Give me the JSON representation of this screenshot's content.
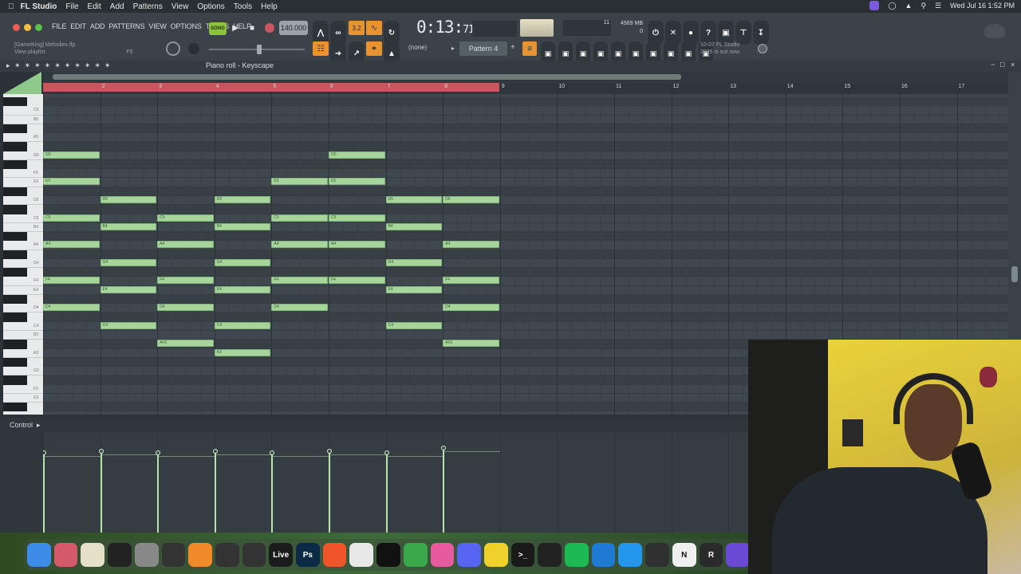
{
  "mac_menu": {
    "app_name": "FL Studio",
    "items": [
      "File",
      "Edit",
      "Add",
      "Patterns",
      "View",
      "Options",
      "Tools",
      "Help"
    ],
    "datetime": "Wed Jul 16  1:52 PM"
  },
  "toolbar": {
    "menu_items": [
      "FILE",
      "EDIT",
      "ADD",
      "PATTERNS",
      "VIEW",
      "OPTIONS",
      "TOOLS",
      "HELP"
    ],
    "project_file": "[GameKing] Melodies.flp",
    "hint_text": "View playlist",
    "hint_key": "F5",
    "song_label": "SONG",
    "tempo": "140.000",
    "time_main": "0:13:",
    "time_sub": "71",
    "pattern_name": "Pattern 4",
    "channel_none": "(none)",
    "cpu_value": "11",
    "memory": "4569 MB",
    "polyphony": "0",
    "news_date": "10-07",
    "news_title": "FL Studio",
    "news_text": "2025 is out now"
  },
  "piano_roll": {
    "title": "Piano roll - Keyscape",
    "bar_numbers": [
      "2",
      "3",
      "4",
      "5",
      "6",
      "7",
      "8",
      "9",
      "10",
      "11",
      "12",
      "13",
      "14",
      "15",
      "16",
      "17"
    ],
    "key_labels": [
      "C6",
      "B5",
      "A5",
      "G5",
      "F5",
      "E5",
      "D5",
      "C5",
      "B4",
      "A4",
      "G4",
      "F4",
      "E4",
      "D4",
      "C4",
      "B3",
      "A3",
      "G3",
      "F3",
      "E3"
    ],
    "notes": [
      {
        "label": "G5",
        "bar": 1,
        "len": 1,
        "row": "G5"
      },
      {
        "label": "G5",
        "bar": 6,
        "len": 1,
        "row": "G5"
      },
      {
        "label": "E5",
        "bar": 1,
        "len": 1,
        "row": "E5"
      },
      {
        "label": "E5",
        "bar": 5,
        "len": 1,
        "row": "E5"
      },
      {
        "label": "E5",
        "bar": 6,
        "len": 1,
        "row": "E5"
      },
      {
        "label": "D5",
        "bar": 2,
        "len": 1,
        "row": "D5"
      },
      {
        "label": "D5",
        "bar": 4,
        "len": 1,
        "row": "D5"
      },
      {
        "label": "D5",
        "bar": 7,
        "len": 1,
        "row": "D5"
      },
      {
        "label": "D5",
        "bar": 8,
        "len": 1,
        "row": "D5"
      },
      {
        "label": "C5",
        "bar": 1,
        "len": 1,
        "row": "C5"
      },
      {
        "label": "C5",
        "bar": 3,
        "len": 1,
        "row": "C5"
      },
      {
        "label": "C5",
        "bar": 5,
        "len": 1,
        "row": "C5"
      },
      {
        "label": "C5",
        "bar": 6,
        "len": 1,
        "row": "C5"
      },
      {
        "label": "B4",
        "bar": 2,
        "len": 1,
        "row": "B4"
      },
      {
        "label": "B4",
        "bar": 4,
        "len": 1,
        "row": "B4"
      },
      {
        "label": "B4",
        "bar": 7,
        "len": 1,
        "row": "B4"
      },
      {
        "label": "A4",
        "bar": 1,
        "len": 1,
        "row": "A4"
      },
      {
        "label": "A4",
        "bar": 3,
        "len": 1,
        "row": "A4"
      },
      {
        "label": "A4",
        "bar": 5,
        "len": 1,
        "row": "A4"
      },
      {
        "label": "A4",
        "bar": 6,
        "len": 1,
        "row": "A4"
      },
      {
        "label": "A4",
        "bar": 8,
        "len": 1,
        "row": "A4"
      },
      {
        "label": "G4",
        "bar": 2,
        "len": 1,
        "row": "G4"
      },
      {
        "label": "G4",
        "bar": 4,
        "len": 1,
        "row": "G4"
      },
      {
        "label": "G4",
        "bar": 7,
        "len": 1,
        "row": "G4"
      },
      {
        "label": "F4",
        "bar": 1,
        "len": 1,
        "row": "F4"
      },
      {
        "label": "F4",
        "bar": 3,
        "len": 1,
        "row": "F4"
      },
      {
        "label": "F4",
        "bar": 5,
        "len": 1,
        "row": "F4"
      },
      {
        "label": "F4",
        "bar": 6,
        "len": 1,
        "row": "F4"
      },
      {
        "label": "F4",
        "bar": 8,
        "len": 1,
        "row": "F4"
      },
      {
        "label": "E4",
        "bar": 2,
        "len": 1,
        "row": "E4"
      },
      {
        "label": "E4",
        "bar": 4,
        "len": 1,
        "row": "E4"
      },
      {
        "label": "E4",
        "bar": 7,
        "len": 1,
        "row": "E4"
      },
      {
        "label": "D4",
        "bar": 1,
        "len": 1,
        "row": "D4"
      },
      {
        "label": "D4",
        "bar": 3,
        "len": 1,
        "row": "D4"
      },
      {
        "label": "D4",
        "bar": 5,
        "len": 1,
        "row": "D4"
      },
      {
        "label": "D4",
        "bar": 8,
        "len": 1,
        "row": "D4"
      },
      {
        "label": "C4",
        "bar": 2,
        "len": 1,
        "row": "C4"
      },
      {
        "label": "C4",
        "bar": 4,
        "len": 1,
        "row": "C4"
      },
      {
        "label": "C4",
        "bar": 7,
        "len": 1,
        "row": "C4"
      },
      {
        "label": "A#3",
        "bar": 3,
        "len": 1,
        "row": "A#3"
      },
      {
        "label": "A#3",
        "bar": 8,
        "len": 1,
        "row": "A#3"
      },
      {
        "label": "A3",
        "bar": 4,
        "len": 1,
        "row": "A3"
      }
    ]
  },
  "control": {
    "label": "Control",
    "velocity_bars": [
      1,
      2,
      3,
      4,
      5,
      6,
      7,
      8
    ]
  },
  "dock": {
    "apps": [
      {
        "name": "finder-icon",
        "text": "",
        "color": "#3d8de8"
      },
      {
        "name": "launchpad-icon",
        "text": "",
        "color": "#d45a6a"
      },
      {
        "name": "notes-icon",
        "text": "",
        "color": "#e6e0c8"
      },
      {
        "name": "activity-icon",
        "text": "",
        "color": "#222"
      },
      {
        "name": "settings-icon",
        "text": "",
        "color": "#888"
      },
      {
        "name": "camera-icon",
        "text": "",
        "color": "#333"
      },
      {
        "name": "fl-studio-icon",
        "text": "",
        "color": "#f08a2a"
      },
      {
        "name": "audio-icon",
        "text": "",
        "color": "#333"
      },
      {
        "name": "gauge-icon",
        "text": "",
        "color": "#333"
      },
      {
        "name": "ableton-icon",
        "text": "Live",
        "color": "#1b1b1b"
      },
      {
        "name": "photoshop-icon",
        "text": "Ps",
        "color": "#0b2a45"
      },
      {
        "name": "brave-icon",
        "text": "",
        "color": "#f0542a"
      },
      {
        "name": "chrome-icon",
        "text": "",
        "color": "#e8e8e8"
      },
      {
        "name": "capcut-icon",
        "text": "",
        "color": "#111"
      },
      {
        "name": "cloud-icon",
        "text": "",
        "color": "#3aa84a"
      },
      {
        "name": "link-icon",
        "text": "",
        "color": "#e85aa0"
      },
      {
        "name": "discord-icon",
        "text": "",
        "color": "#5865f2"
      },
      {
        "name": "pencil-icon",
        "text": "",
        "color": "#f0d02a"
      },
      {
        "name": "terminal-icon",
        "text": ">_",
        "color": "#1a1a1a"
      },
      {
        "name": "box-icon",
        "text": "",
        "color": "#222"
      },
      {
        "name": "spotify-icon",
        "text": "",
        "color": "#1db954"
      },
      {
        "name": "vscode-icon",
        "text": "",
        "color": "#1f7ad4"
      },
      {
        "name": "docker-icon",
        "text": "",
        "color": "#2496ed"
      },
      {
        "name": "obs-icon",
        "text": "",
        "color": "#303030"
      },
      {
        "name": "notion-icon",
        "text": "N",
        "color": "#f0f0f0"
      },
      {
        "name": "r-icon",
        "text": "R",
        "color": "#2a2a2a"
      },
      {
        "name": "menu-app-icon",
        "text": "",
        "color": "#6a4ad4"
      }
    ]
  },
  "colors": {
    "note_fill": "#a6d49b",
    "loop_bar": "#c9565e",
    "accent_orange": "#e8932f",
    "grid_bg": "#3e474d"
  }
}
